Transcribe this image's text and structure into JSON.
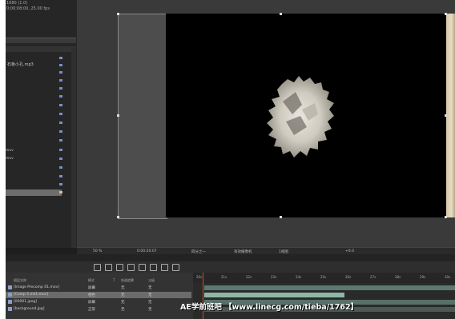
{
  "project": {
    "top_lines": [
      "1080 (1.0)",
      "0;00;08;00, 25.00 fps"
    ],
    "items": [
      {
        "label": "石板小孔.mp3"
      },
      {
        "label": "mov"
      },
      {
        "label": "mov"
      }
    ]
  },
  "viewer": {
    "zoom": "50 %",
    "timecode": "0:00:20:07",
    "resolution": "四分之一",
    "camera": "有效摄像机",
    "views": "1视图",
    "exposure": "+0.0"
  },
  "timeline": {
    "columns": {
      "name": "图层名称",
      "mode": "模式",
      "trkmat": "T",
      "track_matte": "轨道遮罩",
      "parent": "父级"
    },
    "layers": [
      {
        "name": "[Image Precomp 01.mov]",
        "mode": "屏幕",
        "trkmat": "无",
        "parent": "无"
      },
      {
        "name": "[Comp 5.ink1.mov]",
        "mode": "相色",
        "trkmat": "无",
        "parent": "无"
      },
      {
        "name": "[00001.jpeg]",
        "mode": "屏幕",
        "trkmat": "无",
        "parent": "无"
      },
      {
        "name": "[background.jpg]",
        "mode": "正常",
        "trkmat": "无",
        "parent": "无"
      }
    ],
    "ruler_ticks": [
      "20s",
      "21s",
      "22s",
      "23s",
      "24s",
      "25s",
      "26s",
      "27s",
      "28s",
      "29s",
      "30s"
    ]
  },
  "watermark": "AE学前班吧 【www.linecg.com/tieba/1762】",
  "colors": {
    "accent_bar": "#7fa79a",
    "cti": "#d04a2a",
    "selection": "#6b6b6b"
  }
}
